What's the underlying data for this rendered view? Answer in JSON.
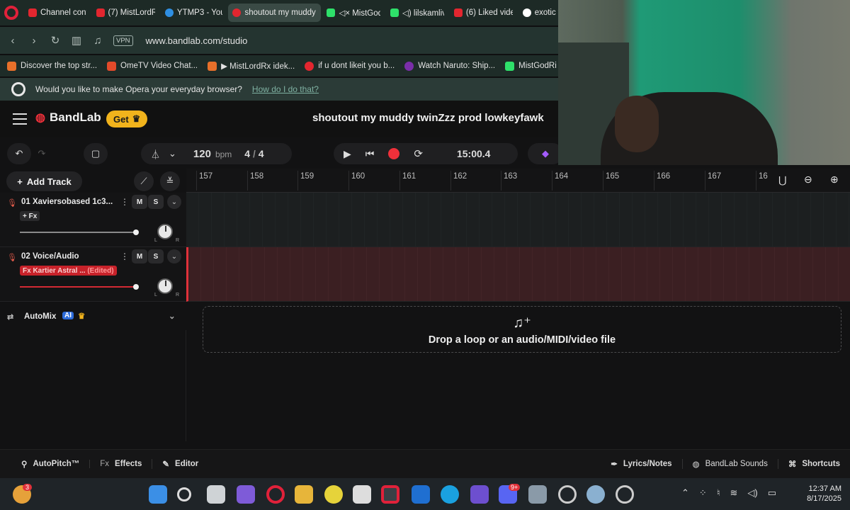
{
  "browser": {
    "tabs": [
      {
        "label": "Channel cont",
        "color": "#e3262f"
      },
      {
        "label": "(7) MistLordR",
        "color": "#e3262f"
      },
      {
        "label": "YTMP3 - You",
        "color": "#2f8fe3"
      },
      {
        "label": "shoutout my muddy t",
        "color": "#e3262f",
        "active": true
      },
      {
        "label": "◁× MistGod",
        "color": "#2ee06a"
      },
      {
        "label": "◁) lilskamliv",
        "color": "#2ee06a"
      },
      {
        "label": "(6) Liked vide",
        "color": "#e3262f"
      },
      {
        "label": "exotic w",
        "color": "#ffffff"
      }
    ],
    "url": "www.bandlab.com/studio",
    "vpn_label": "VPN",
    "bookmarks": [
      {
        "label": "Discover the top str...",
        "color": "#e8702a"
      },
      {
        "label": "OmeTV Video Chat...",
        "color": "#e34a2a"
      },
      {
        "label": "▶ MistLordRx idek...",
        "color": "#e8702a"
      },
      {
        "label": "if u dont likeit you b...",
        "color": "#e3262f"
      },
      {
        "label": "Watch Naruto: Ship...",
        "color": "#7a2ea8"
      },
      {
        "label": "MistGodRi",
        "color": "#2ee06a"
      }
    ],
    "opera_prompt": "Would you like to make Opera your everyday browser?",
    "opera_link": "How do I do that?"
  },
  "app": {
    "brand": "BandLab",
    "get_label": "Get",
    "project_title": "shoutout my muddy twinZzz prod lowkeyfawk",
    "tempo": "120",
    "tempo_unit": "bpm",
    "time_sig_num": "4",
    "time_sig_sep": "/",
    "time_sig_den": "4",
    "time": "15:00.4",
    "add_track_label": "Add Track",
    "ruler": [
      "157",
      "158",
      "159",
      "160",
      "161",
      "162",
      "163",
      "164",
      "165",
      "166",
      "167",
      "16"
    ],
    "tracks": [
      {
        "name": "01  Xaviersobased 1c3...",
        "fx": "+ Fx",
        "mute": "M",
        "solo": "S"
      },
      {
        "name": "02  Voice/Audio",
        "fx": "Fx Kartier Astral ...",
        "fx_edited": "(Edited)",
        "mute": "M",
        "solo": "S"
      }
    ],
    "automix_label": "AutoMix",
    "ai_label": "AI",
    "dropzone_label": "Drop a loop or an audio/MIDI/video file",
    "bottom_bar": {
      "autopitch": "AutoPitch™",
      "fx_prefix": "Fx",
      "effects": "Effects",
      "editor": "Editor",
      "lyrics": "Lyrics/Notes",
      "sounds": "BandLab Sounds",
      "shortcuts": "Shortcuts"
    },
    "accent_color": "#f0303a",
    "get_color": "#f1b31c"
  },
  "taskbar": {
    "time": "12:37 AM",
    "date": "8/17/2025",
    "notify_badge": "3",
    "discord_badge": "9+"
  }
}
